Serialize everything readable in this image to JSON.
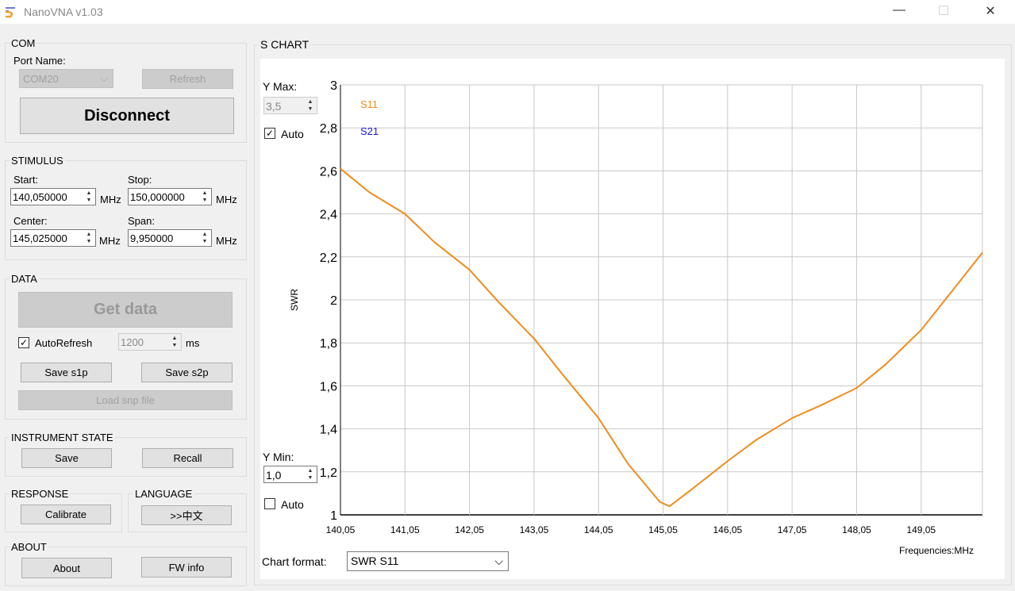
{
  "window": {
    "title": "NanoVNA v1.03",
    "minimize": "—",
    "maximize": "☐",
    "close": "✕"
  },
  "com": {
    "label": "COM",
    "port_label": "Port Name:",
    "port_value": "COM20",
    "refresh": "Refresh",
    "disconnect": "Disconnect"
  },
  "stimulus": {
    "label": "STIMULUS",
    "start_label": "Start:",
    "start": "140,050000",
    "stop_label": "Stop:",
    "stop": "150,000000",
    "center_label": "Center:",
    "center": "145,025000",
    "span_label": "Span:",
    "span": "9,950000",
    "unit": "MHz"
  },
  "data": {
    "label": "DATA",
    "get_data": "Get data",
    "autorefresh_label": "AutoRefresh",
    "autorefresh_checked": true,
    "interval": "1200",
    "interval_unit": "ms",
    "save_s1p": "Save s1p",
    "save_s2p": "Save s2p",
    "load_snp": "Load snp file"
  },
  "instrument": {
    "label": "INSTRUMENT STATE",
    "save": "Save",
    "recall": "Recall"
  },
  "response": {
    "label": "RESPONSE",
    "calibrate": "Calibrate"
  },
  "language": {
    "label": "LANGUAGE",
    "button": ">>中文"
  },
  "about": {
    "label": "ABOUT",
    "about": "About",
    "fw_info": "FW info"
  },
  "chart_panel": {
    "label": "S CHART",
    "ymax_label": "Y Max:",
    "ymax": "3,5",
    "ymax_auto": "Auto",
    "ymax_auto_checked": true,
    "ymin_label": "Y Min:",
    "ymin": "1,0",
    "ymin_auto": "Auto",
    "ymin_auto_checked": false,
    "format_label": "Chart format:",
    "format_value": "SWR S11",
    "freq_label": "Frequencies:MHz"
  },
  "colors": {
    "s11": "#f08c1c",
    "s21": "#1a1acc",
    "grid": "#c8c8c8"
  },
  "chart_data": {
    "type": "line",
    "ylabel": "SWR",
    "xlabel": "Frequencies:MHz",
    "xlim": [
      140.05,
      150.0
    ],
    "ylim": [
      1,
      3
    ],
    "grid": true,
    "legend": "top-left",
    "xticks": [
      "140,05",
      "141,05",
      "142,05",
      "143,05",
      "144,05",
      "145,05",
      "146,05",
      "147,05",
      "148,05",
      "149,05"
    ],
    "yticks": [
      "1",
      "1,2",
      "1,4",
      "1,6",
      "1,8",
      "2",
      "2,2",
      "2,4",
      "2,6",
      "2,8",
      "3"
    ],
    "series": [
      {
        "name": "S11",
        "x": [
          140.05,
          140.5,
          141.05,
          141.5,
          142.05,
          142.5,
          143.05,
          143.5,
          144.05,
          144.5,
          145.0,
          145.15,
          145.5,
          146.05,
          146.5,
          147.05,
          147.5,
          148.05,
          148.5,
          149.05,
          149.5,
          150.0
        ],
        "y": [
          2.61,
          2.5,
          2.4,
          2.27,
          2.14,
          1.99,
          1.82,
          1.65,
          1.45,
          1.24,
          1.06,
          1.04,
          1.12,
          1.25,
          1.35,
          1.45,
          1.51,
          1.59,
          1.7,
          1.86,
          2.03,
          2.22
        ]
      },
      {
        "name": "S21",
        "x": [],
        "y": []
      }
    ]
  }
}
